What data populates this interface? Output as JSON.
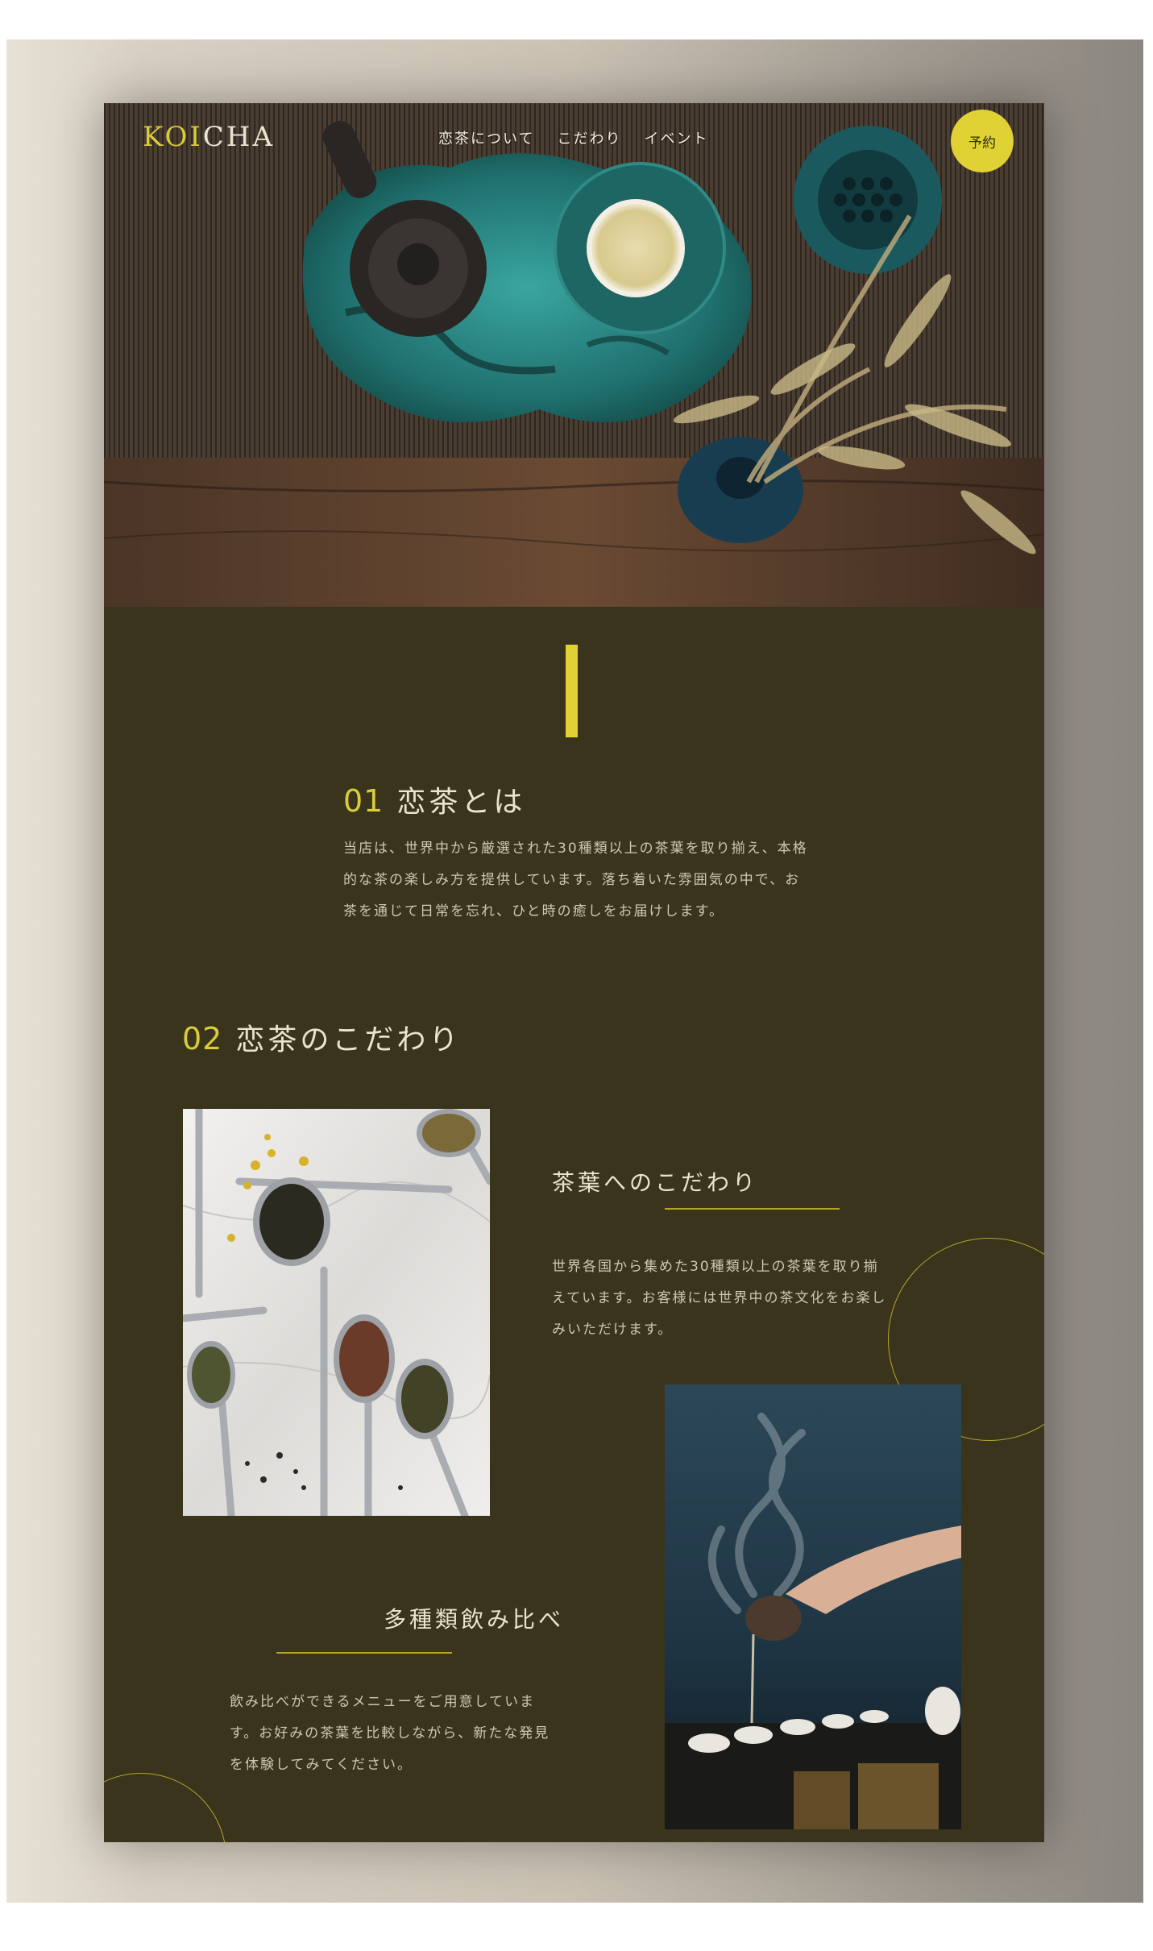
{
  "header": {
    "logo_accent": "KOI",
    "logo_rest": "CHA",
    "nav": [
      "恋茶について",
      "こだわり",
      "イベント"
    ],
    "reserve_label": "予約"
  },
  "section1": {
    "number": "01",
    "title": "恋茶とは",
    "body": "当店は、世界中から厳選された30種類以上の茶葉を取り揃え、本格的な茶の楽しみ方を提供しています。落ち着いた雰囲気の中で、お茶を通じて日常を忘れ、ひと時の癒しをお届けします。"
  },
  "section2": {
    "number": "02",
    "title": "恋茶のこだわり",
    "feature1": {
      "title": "茶葉へのこだわり",
      "body": "世界各国から集めた30種類以上の茶葉を取り揃えています。お客様には世界中の茶文化をお楽しみいただけます。"
    },
    "feature2": {
      "title": "多種類飲み比べ",
      "body": "飲み比べができるメニューをご用意しています。お好みの茶葉を比較しながら、新たな発見を体験してみてください。"
    }
  },
  "colors": {
    "background": "#3a341d",
    "accent": "#e0d235",
    "text": "#e9e3cf"
  }
}
